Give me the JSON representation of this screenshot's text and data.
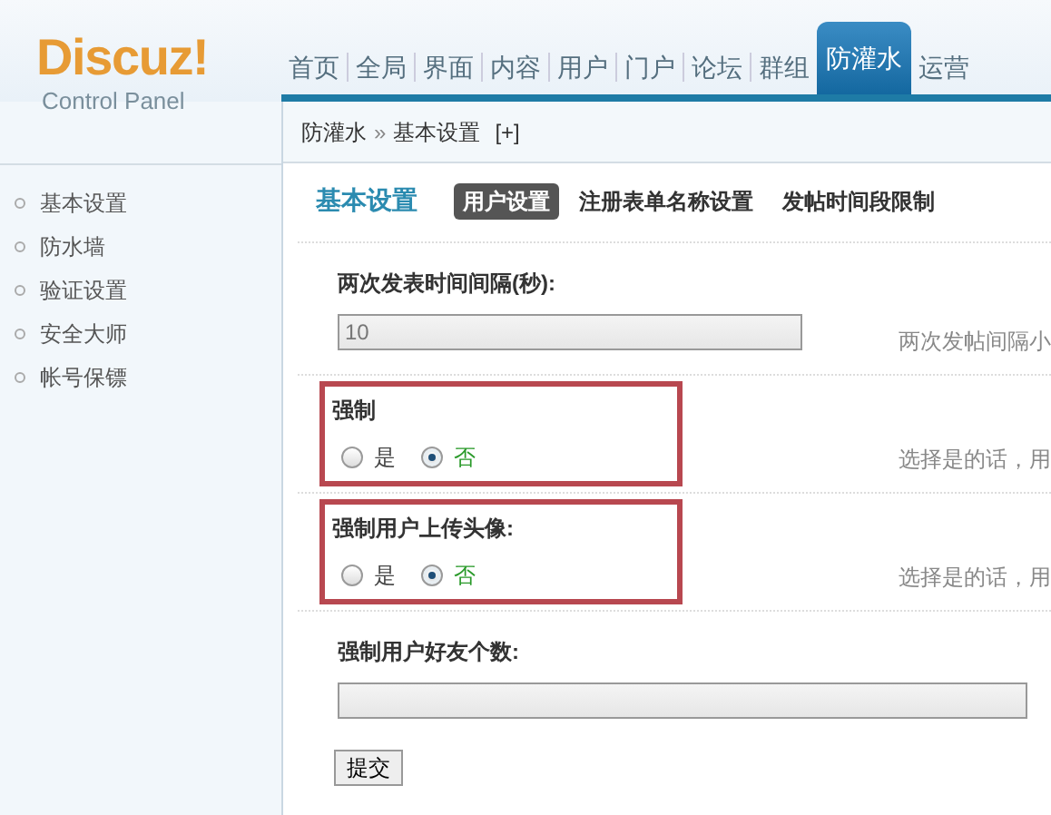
{
  "logo": {
    "name": "Discuz!",
    "subtitle": "Control Panel"
  },
  "nav": [
    {
      "label": "首页",
      "selected": false
    },
    {
      "label": "全局",
      "selected": false
    },
    {
      "label": "界面",
      "selected": false
    },
    {
      "label": "内容",
      "selected": false
    },
    {
      "label": "用户",
      "selected": false
    },
    {
      "label": "门户",
      "selected": false
    },
    {
      "label": "论坛",
      "selected": false
    },
    {
      "label": "群组",
      "selected": false
    },
    {
      "label": "防灌水",
      "selected": true
    },
    {
      "label": "运营",
      "selected": false
    }
  ],
  "breadcrumb": {
    "section": "防灌水",
    "separator": "»",
    "page": "基本设置",
    "toggle": "[+]"
  },
  "sidebar": {
    "items": [
      {
        "label": "基本设置"
      },
      {
        "label": "防水墙"
      },
      {
        "label": "验证设置"
      },
      {
        "label": "安全大师"
      },
      {
        "label": "帐号保镖"
      }
    ]
  },
  "content": {
    "title": "基本设置",
    "tabs": [
      {
        "label": "用户设置",
        "selected": true
      },
      {
        "label": "注册表单名称设置",
        "selected": false
      },
      {
        "label": "发帖时间段限制",
        "selected": false
      }
    ],
    "settings": [
      {
        "kind": "text",
        "label": "两次发表时间间隔(秒):",
        "value": "10",
        "hint": "两次发帖间隔小",
        "highlighted": false
      },
      {
        "kind": "radio",
        "label": "强制",
        "options": [
          {
            "label": "是",
            "selected": false
          },
          {
            "label": "否",
            "selected": true
          }
        ],
        "hint": "选择是的话，用",
        "highlighted": true
      },
      {
        "kind": "radio",
        "label": "强制用户上传头像:",
        "options": [
          {
            "label": "是",
            "selected": false
          },
          {
            "label": "否",
            "selected": true
          }
        ],
        "hint": "选择是的话，用",
        "highlighted": true
      },
      {
        "kind": "text",
        "label": "强制用户好友个数:",
        "highlighted": false
      }
    ],
    "submit": "提交"
  }
}
